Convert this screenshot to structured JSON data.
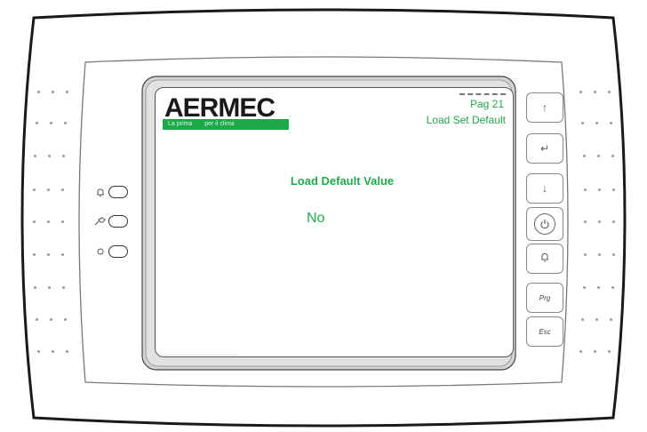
{
  "header": {
    "brand": "AERMEC",
    "tagline_left": "La prima",
    "tagline_right": "per il clima",
    "page_label": "Pag 21",
    "page_title": "Load Set Default"
  },
  "main": {
    "field_label": "Load Default Value",
    "field_value": "No"
  },
  "keypad": {
    "up_icon": "↑",
    "enter_icon": "↵",
    "down_icon": "↓",
    "power_icon": "⏻",
    "alarm_icon": "bell",
    "prg_label": "Prg",
    "esc_label": "Esc"
  },
  "indicators": [
    {
      "icon": "alarm-led-icon"
    },
    {
      "icon": "service-led-icon"
    },
    {
      "icon": "power-led-icon"
    }
  ],
  "colors": {
    "screen_text": "#22a84a",
    "brand_bar": "#1fa84a"
  }
}
